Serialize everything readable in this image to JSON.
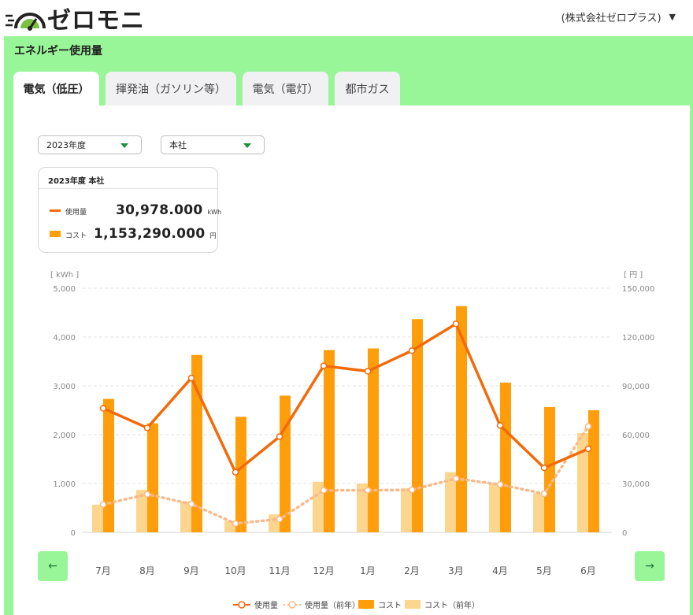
{
  "header": {
    "logo_text": "ゼロモニ",
    "company": "(株式会社ゼロプラス)",
    "company_caret": "▼"
  },
  "panel": {
    "title": "エネルギー使用量"
  },
  "tabs": [
    {
      "label": "電気（低圧）",
      "active": true
    },
    {
      "label": "揮発油（ガソリン等）",
      "active": false
    },
    {
      "label": "電気（電灯）",
      "active": false
    },
    {
      "label": "都市ガス",
      "active": false
    }
  ],
  "filters": {
    "year": "2023年度",
    "site": "本社"
  },
  "summary": {
    "heading": "2023年度 本社",
    "usage_label": "使用量",
    "usage_value": "30,978.000",
    "usage_unit": "kWh",
    "cost_label": "コスト",
    "cost_value": "1,153,290.000",
    "cost_unit": "円"
  },
  "nav": {
    "prev_glyph": "←",
    "next_glyph": "→"
  },
  "colors": {
    "usage": "#f26a0a",
    "usage_prev": "#f9b98a",
    "cost": "#ff9e0a",
    "cost_prev": "#fcd58e",
    "accent_green": "#98f598",
    "arrow_green": "#1e8f3a"
  },
  "chart_data": {
    "type": "bar",
    "categories": [
      "7月",
      "8月",
      "9月",
      "10月",
      "11月",
      "12月",
      "1月",
      "2月",
      "3月",
      "4月",
      "5月",
      "6月"
    ],
    "left_axis": {
      "label": "[ kWh ]",
      "ticks": [
        "5,000",
        "4,000",
        "3,000",
        "2,000",
        "1,000",
        "0"
      ],
      "range": [
        0,
        5000
      ]
    },
    "right_axis": {
      "label": "[ 円 ]",
      "ticks": [
        "150,000",
        "120,000",
        "90,000",
        "60,000",
        "30,000",
        "0"
      ],
      "range": [
        0,
        150000
      ]
    },
    "series": [
      {
        "name": "使用量",
        "kind": "line",
        "axis": "left",
        "values": [
          2540,
          2140,
          3160,
          1230,
          1960,
          3410,
          3300,
          3720,
          4270,
          2190,
          1320,
          1710
        ]
      },
      {
        "name": "使用量（前年）",
        "kind": "dotted-line",
        "axis": "left",
        "values": [
          570,
          780,
          580,
          180,
          270,
          860,
          860,
          870,
          1100,
          980,
          790,
          2170
        ]
      },
      {
        "name": "コスト",
        "kind": "bar",
        "axis": "right",
        "values": [
          82000,
          67000,
          109000,
          71000,
          84000,
          112000,
          113000,
          131000,
          139000,
          92000,
          77000,
          75000
        ]
      },
      {
        "name": "コスト（前年）",
        "kind": "bar",
        "axis": "right",
        "values": [
          17000,
          26000,
          19000,
          7000,
          11000,
          31000,
          30000,
          27000,
          37000,
          30000,
          24000,
          61000
        ]
      }
    ],
    "legend": [
      "使用量",
      "使用量（前年）",
      "コスト",
      "コスト（前年）"
    ],
    "legend_position": "bottom",
    "grid": true
  }
}
